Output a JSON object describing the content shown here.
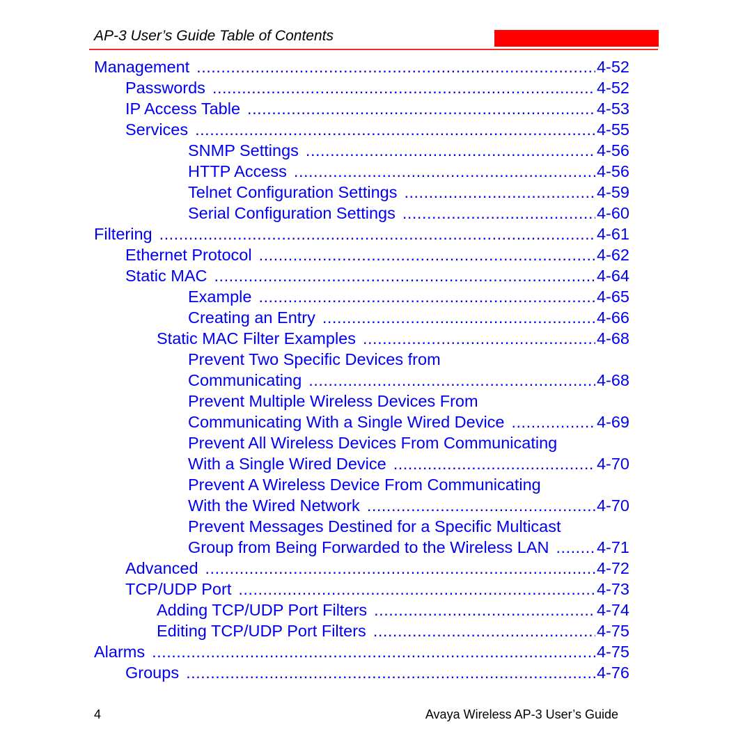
{
  "header": {
    "title": "AP-3 User’s Guide Table of Contents",
    "accent_color": "#ff0000"
  },
  "toc": [
    {
      "level": 0,
      "label": "Management",
      "page": "4-52"
    },
    {
      "level": 1,
      "label": "Passwords",
      "page": "4-52"
    },
    {
      "level": 1,
      "label": "IP Access Table",
      "page": "4-53"
    },
    {
      "level": 1,
      "label": "Services",
      "page": "4-55"
    },
    {
      "level": 3,
      "label": "SNMP Settings",
      "page": "4-56"
    },
    {
      "level": 3,
      "label": "HTTP Access",
      "page": "4-56"
    },
    {
      "level": 3,
      "label": "Telnet Configuration Settings",
      "page": "4-59"
    },
    {
      "level": 3,
      "label": "Serial Configuration Settings",
      "page": "4-60"
    },
    {
      "level": 0,
      "label": "Filtering",
      "page": "4-61"
    },
    {
      "level": 1,
      "label": "Ethernet Protocol",
      "page": "4-62"
    },
    {
      "level": 1,
      "label": "Static MAC",
      "page": "4-64"
    },
    {
      "level": 3,
      "label": "Example",
      "page": "4-65"
    },
    {
      "level": 3,
      "label": "Creating an Entry",
      "page": "4-66"
    },
    {
      "level": 2,
      "label": "Static MAC Filter Examples",
      "page": "4-68"
    },
    {
      "level": 3,
      "label": "Prevent Two Specific Devices from",
      "page": null
    },
    {
      "level": 3,
      "label": "Communicating",
      "page": "4-68"
    },
    {
      "level": 3,
      "label": "Prevent Multiple Wireless Devices From",
      "page": null
    },
    {
      "level": 3,
      "label": "Communicating With a Single Wired Device",
      "page": "4-69"
    },
    {
      "level": 3,
      "label": "Prevent All Wireless Devices From Communicating",
      "page": null
    },
    {
      "level": 3,
      "label": "With a Single Wired Device",
      "page": "4-70"
    },
    {
      "level": 3,
      "label": "Prevent A Wireless Device From Communicating",
      "page": null
    },
    {
      "level": 3,
      "label": "With the Wired Network",
      "page": "4-70"
    },
    {
      "level": 3,
      "label": "Prevent Messages Destined for a Specific Multicast",
      "page": null
    },
    {
      "level": 3,
      "label": "Group from Being Forwarded to the Wireless LAN",
      "page": "4-71"
    },
    {
      "level": 1,
      "label": "Advanced",
      "page": "4-72"
    },
    {
      "level": 1,
      "label": "TCP/UDP Port",
      "page": "4-73"
    },
    {
      "level": 2,
      "label": "Adding TCP/UDP Port Filters",
      "page": "4-74"
    },
    {
      "level": 2,
      "label": "Editing TCP/UDP Port Filters",
      "page": "4-75"
    },
    {
      "level": 0,
      "label": "Alarms",
      "page": "4-75"
    },
    {
      "level": 1,
      "label": "Groups",
      "page": "4-76"
    }
  ],
  "footer": {
    "page_number": "4",
    "title": "Avaya Wireless AP-3 User’s Guide"
  }
}
